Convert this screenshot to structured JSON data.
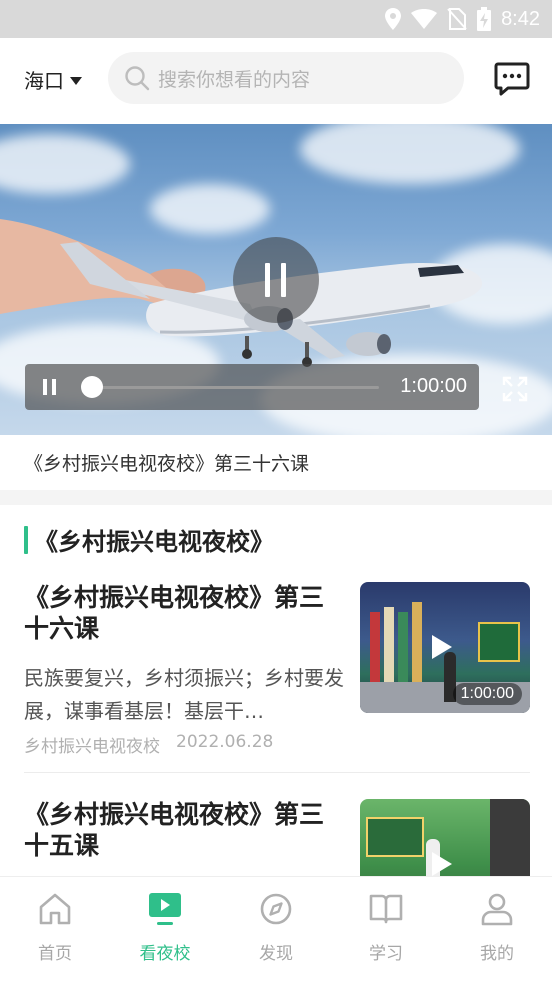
{
  "status_bar": {
    "time": "8:42"
  },
  "header": {
    "city": "海口",
    "search_placeholder": "搜索你想看的内容"
  },
  "player": {
    "duration": "1:00:00",
    "progress": 0.0,
    "title": "《乡村振兴电视夜校》第三十六课"
  },
  "section": {
    "title": "《乡村振兴电视夜校》"
  },
  "items": [
    {
      "title": "《乡村振兴电视夜校》第三十六课",
      "desc": "民族要复兴，乡村须振兴；乡村要发展，谋事看基层！基层干…",
      "source": "乡村振兴电视夜校",
      "date": "2022.06.28",
      "duration": "1:00:00"
    },
    {
      "title": "《乡村振兴电视夜校》第三十五课",
      "desc": "",
      "source": "",
      "date": "",
      "duration": ""
    }
  ],
  "tabs": [
    {
      "label": "首页",
      "icon": "home-icon",
      "active": false
    },
    {
      "label": "看夜校",
      "icon": "tv-play-icon",
      "active": true
    },
    {
      "label": "发现",
      "icon": "compass-icon",
      "active": false
    },
    {
      "label": "学习",
      "icon": "book-icon",
      "active": false
    },
    {
      "label": "我的",
      "icon": "user-icon",
      "active": false
    }
  ],
  "colors": {
    "accent": "#2fbf8a",
    "inactive": "#a7a7a7"
  }
}
